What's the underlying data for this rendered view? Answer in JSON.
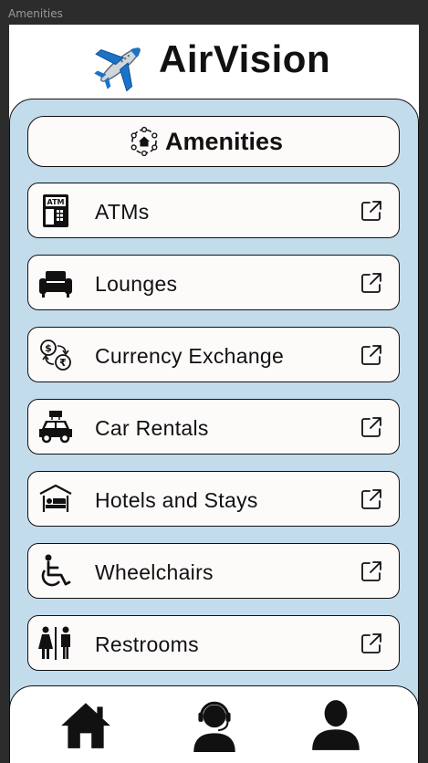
{
  "window": {
    "title": "Amenities"
  },
  "app": {
    "name": "AirVision",
    "logo_icon": "airplane-icon"
  },
  "section": {
    "title": "Amenities",
    "icon": "amenities-hub-icon"
  },
  "amenities": [
    {
      "label": "ATMs",
      "icon": "atm-icon"
    },
    {
      "label": "Lounges",
      "icon": "sofa-icon"
    },
    {
      "label": "Currency Exchange",
      "icon": "currency-exchange-icon"
    },
    {
      "label": "Car Rentals",
      "icon": "car-rental-icon"
    },
    {
      "label": "Hotels and Stays",
      "icon": "bed-icon"
    },
    {
      "label": "Wheelchairs",
      "icon": "wheelchair-icon"
    },
    {
      "label": "Restrooms",
      "icon": "restroom-icon"
    }
  ],
  "nav": [
    {
      "icon": "home-icon"
    },
    {
      "icon": "support-agent-icon"
    },
    {
      "icon": "profile-icon"
    }
  ],
  "colors": {
    "panel": "#c3dcec",
    "card": "#fdfafa",
    "plane": "#1a73c8",
    "text": "#111111"
  }
}
